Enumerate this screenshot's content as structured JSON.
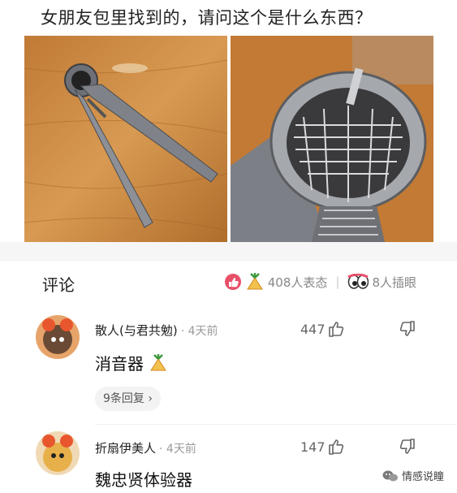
{
  "post": {
    "title": "女朋友包里找到的，请问这个是什么东西？"
  },
  "comments_header": {
    "title": "评论",
    "reaction_count_label": "408人表态",
    "separator": "|",
    "eye_roll_label": "8人插眼"
  },
  "comments": [
    {
      "username": "散人(与君共勉)",
      "time": "· 4天前",
      "likes": "447",
      "text": "消音器",
      "replies_label": "9条回复 ›"
    },
    {
      "username": "折扇伊美人",
      "time": "· 4天前",
      "likes": "147",
      "text": "魏忠贤体验器"
    }
  ],
  "watermark": {
    "label": "情感说瞳"
  },
  "colors": {
    "like_badge": "#e8506a",
    "wood_light": "#c9863d",
    "wood_dark": "#a8652a",
    "metal": "#8d9096"
  }
}
